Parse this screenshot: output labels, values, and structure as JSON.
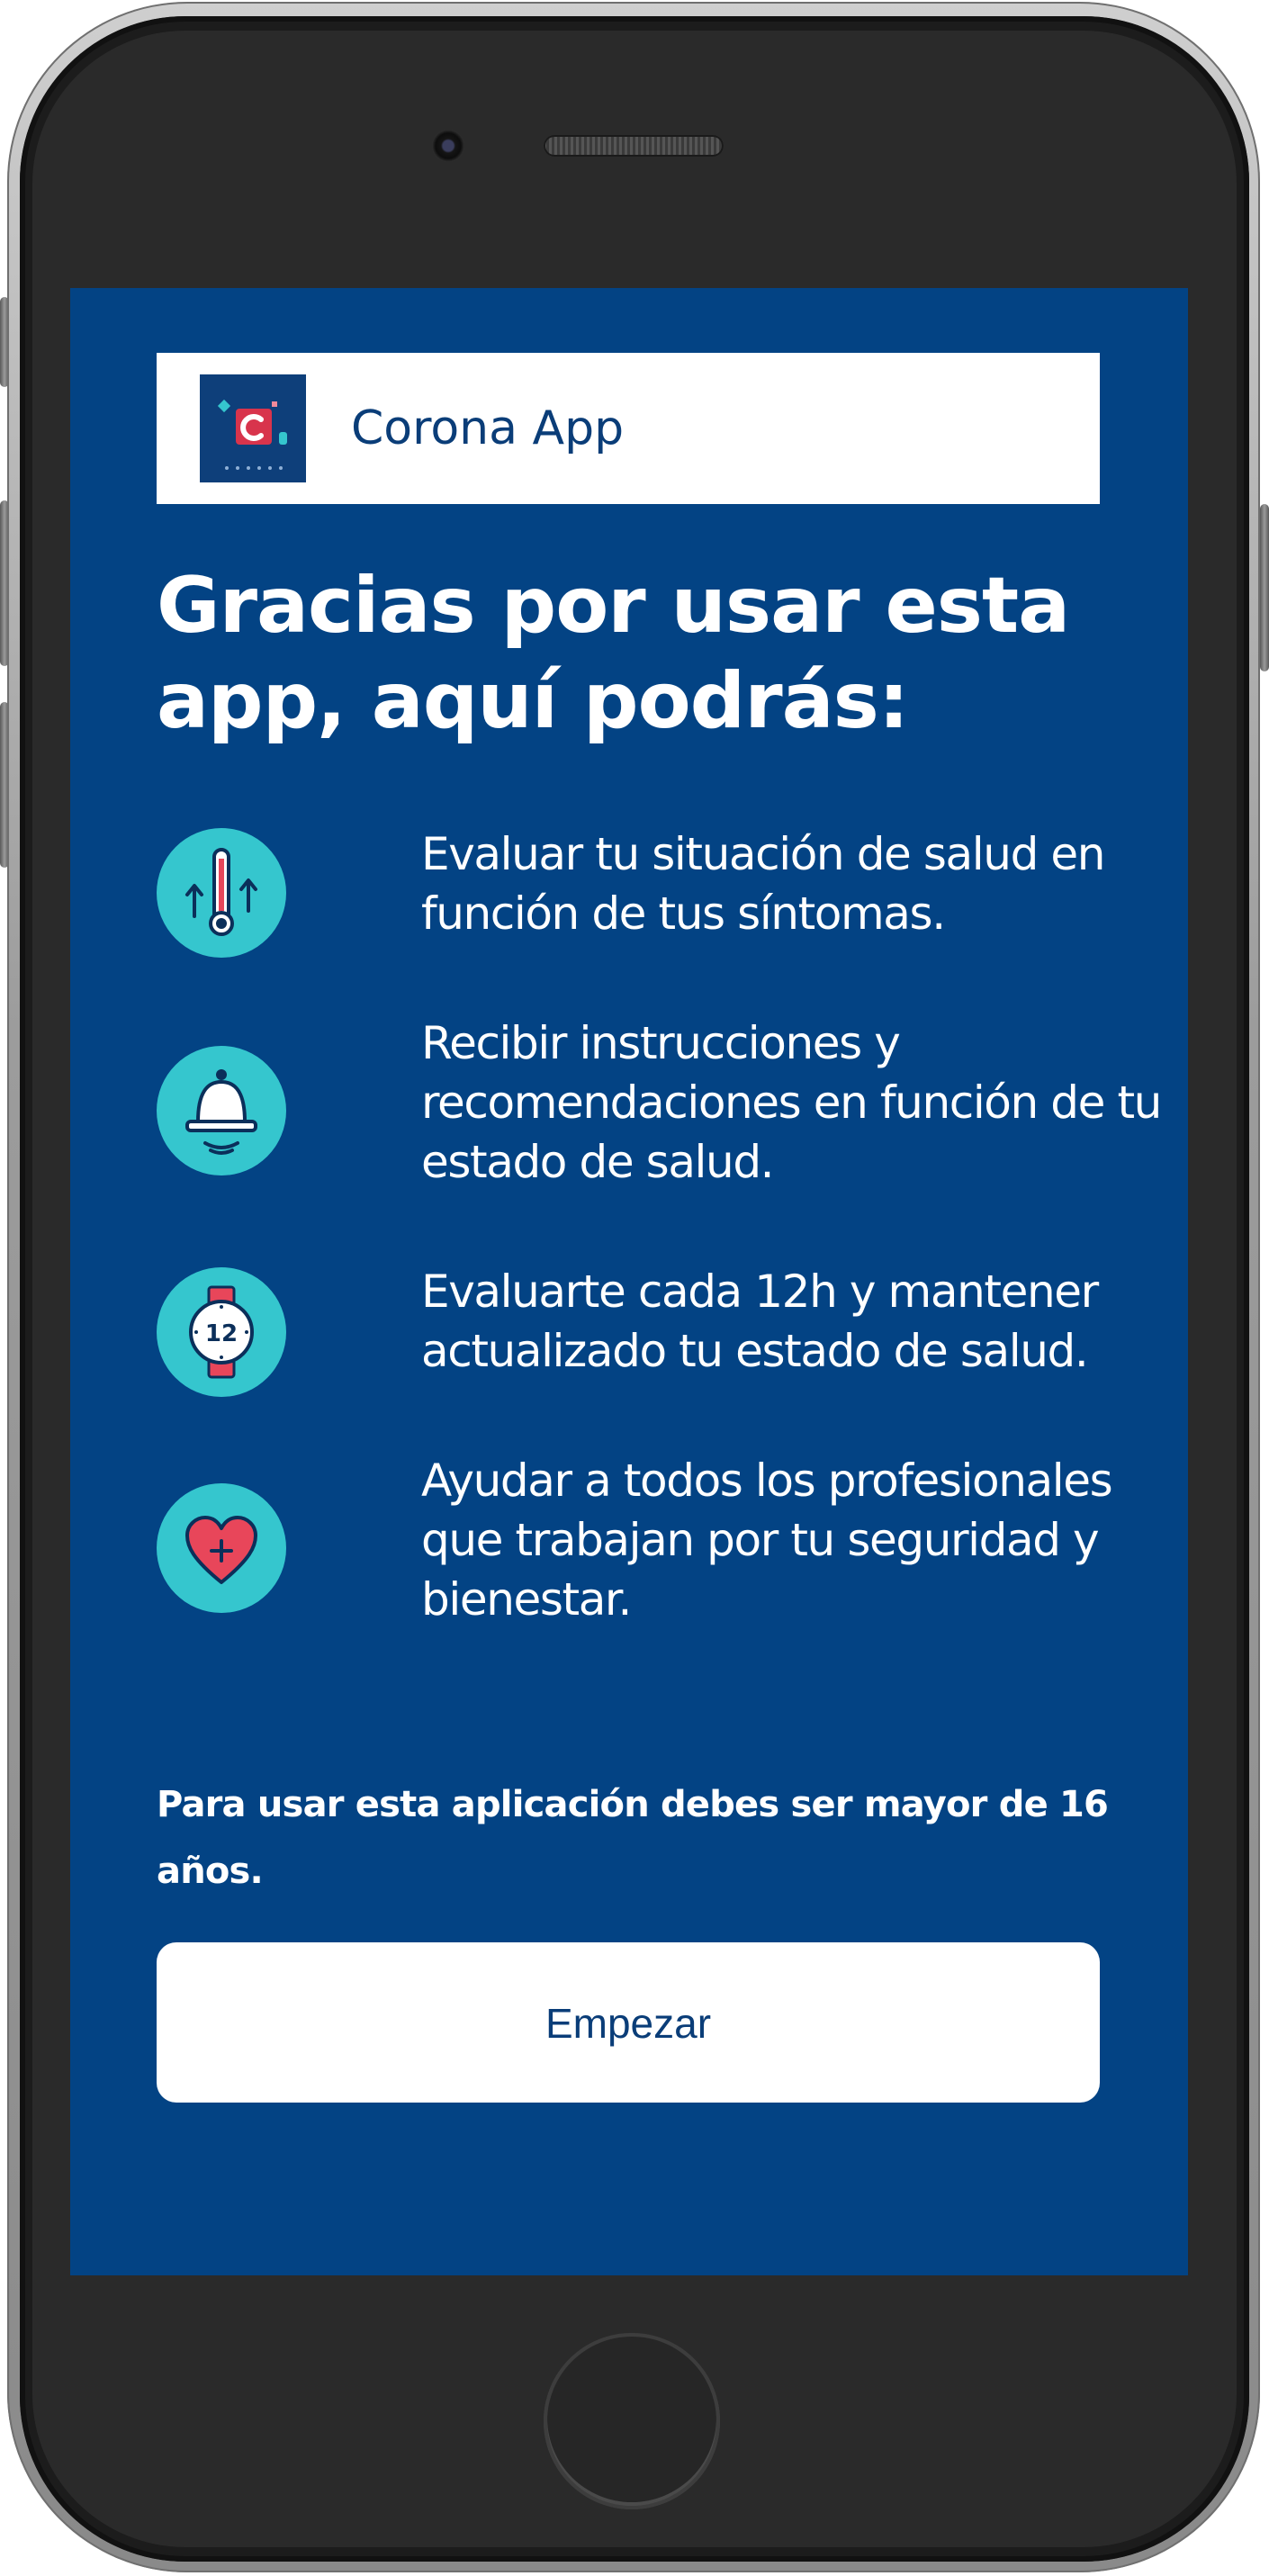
{
  "header": {
    "app_name": "Corona App",
    "logo_icon": "corona-app-logo"
  },
  "headline": "Gracias por usar esta app, aquí podrás:",
  "features": [
    {
      "icon": "thermometer-icon",
      "text": "Evaluar tu situación de salud en función de tus síntomas."
    },
    {
      "icon": "bell-icon",
      "text": "Recibir instrucciones y recomendaciones en función de tu estado de salud."
    },
    {
      "icon": "watch-icon",
      "text": "Evaluarte cada 12h y mantener actualizado tu estado de salud."
    },
    {
      "icon": "heart-icon",
      "text": "Ayudar a todos los profesionales que trabajan por tu seguridad y bienestar."
    }
  ],
  "watch_label": "12",
  "age_note": "Para usar esta aplicación debes ser mayor de 16 años.",
  "start_button": "Empezar",
  "colors": {
    "background": "#034384",
    "icon_circle": "#35c6ce",
    "accent_red": "#e8465a",
    "button_text": "#0a3d78"
  }
}
